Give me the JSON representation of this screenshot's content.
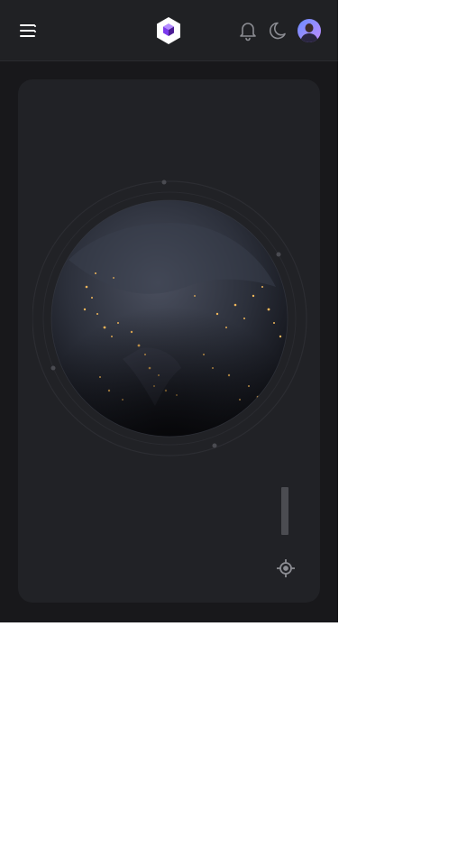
{
  "header": {
    "menu_icon": "hamburger-menu-icon",
    "logo_icon": "cube-logo-icon",
    "notifications_icon": "bell-icon",
    "theme_toggle_icon": "moon-icon",
    "avatar_icon": "user-avatar"
  },
  "map_card": {
    "globe": "earth-at-night-globe",
    "zoom_control_icon": "zoom-slider",
    "locate_icon": "crosshair-locate-icon"
  },
  "colors": {
    "app_background": "#18181b",
    "header_background": "#202124",
    "card_background": "#212226",
    "accent": "#7c3aed",
    "city_lights": "#f2b75a"
  }
}
